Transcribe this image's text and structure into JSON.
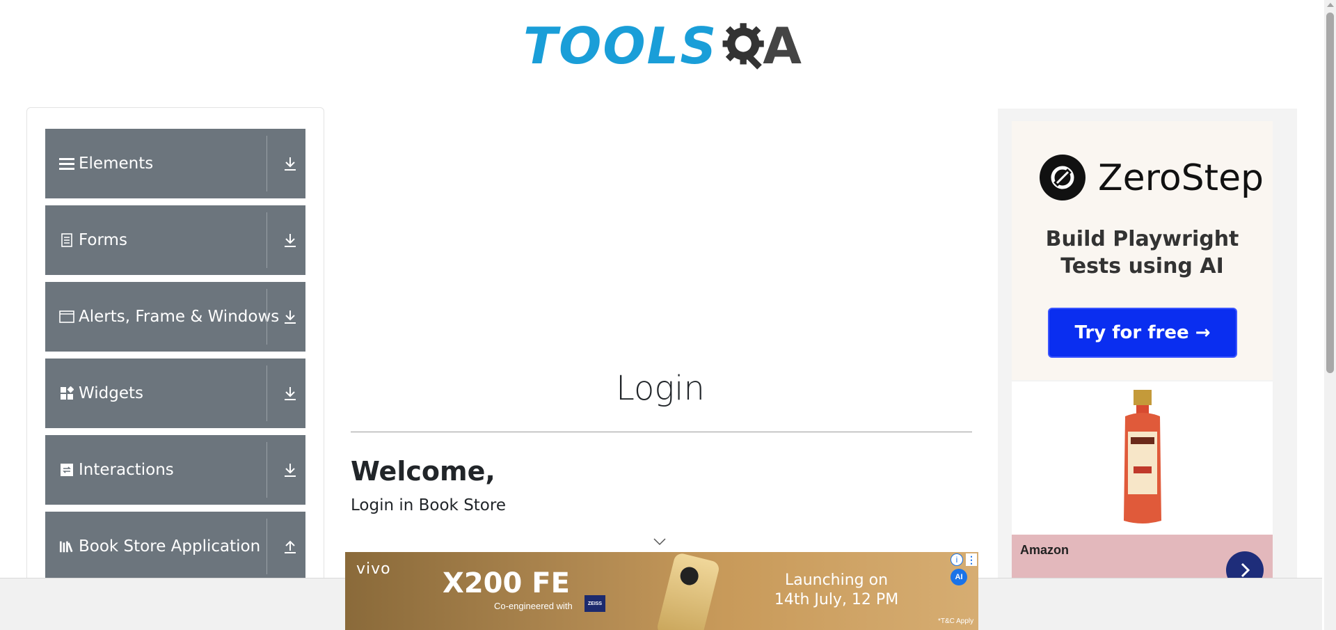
{
  "header": {
    "logo_text": "TOOLS",
    "logo_tail": "A"
  },
  "sidebar": {
    "groups": [
      {
        "label": "Elements",
        "icon": "menu-icon",
        "arrow": "download"
      },
      {
        "label": "Forms",
        "icon": "document-icon",
        "arrow": "download"
      },
      {
        "label": "Alerts, Frame & Windows",
        "icon": "window-icon",
        "arrow": "download"
      },
      {
        "label": "Widgets",
        "icon": "widgets-icon",
        "arrow": "download"
      },
      {
        "label": "Interactions",
        "icon": "interactions-icon",
        "arrow": "download"
      },
      {
        "label": "Book Store Application",
        "icon": "books-icon",
        "arrow": "upload"
      }
    ]
  },
  "main": {
    "title": "Login",
    "welcome": "Welcome,",
    "subtitle": "Login in Book Store"
  },
  "right_ad": {
    "brand": "ZeroStep",
    "tagline_line1": "Build Playwright",
    "tagline_line2": "Tests using AI",
    "cta": "Try for free →",
    "store": "Amazon"
  },
  "bottom_ad": {
    "brand": "vivo",
    "model": "X200 FE",
    "coengineered": "Co-engineered with",
    "zeiss": "ZEISS",
    "launch_line1": "Launching on",
    "launch_line2": "14th July, 12 PM",
    "tnc": "*T&C Apply",
    "ai_badge": "AI"
  },
  "colors": {
    "logo_blue": "#1a9ed8",
    "sidebar_group_bg": "#6c757d",
    "cta_blue": "#0a2ef0"
  }
}
